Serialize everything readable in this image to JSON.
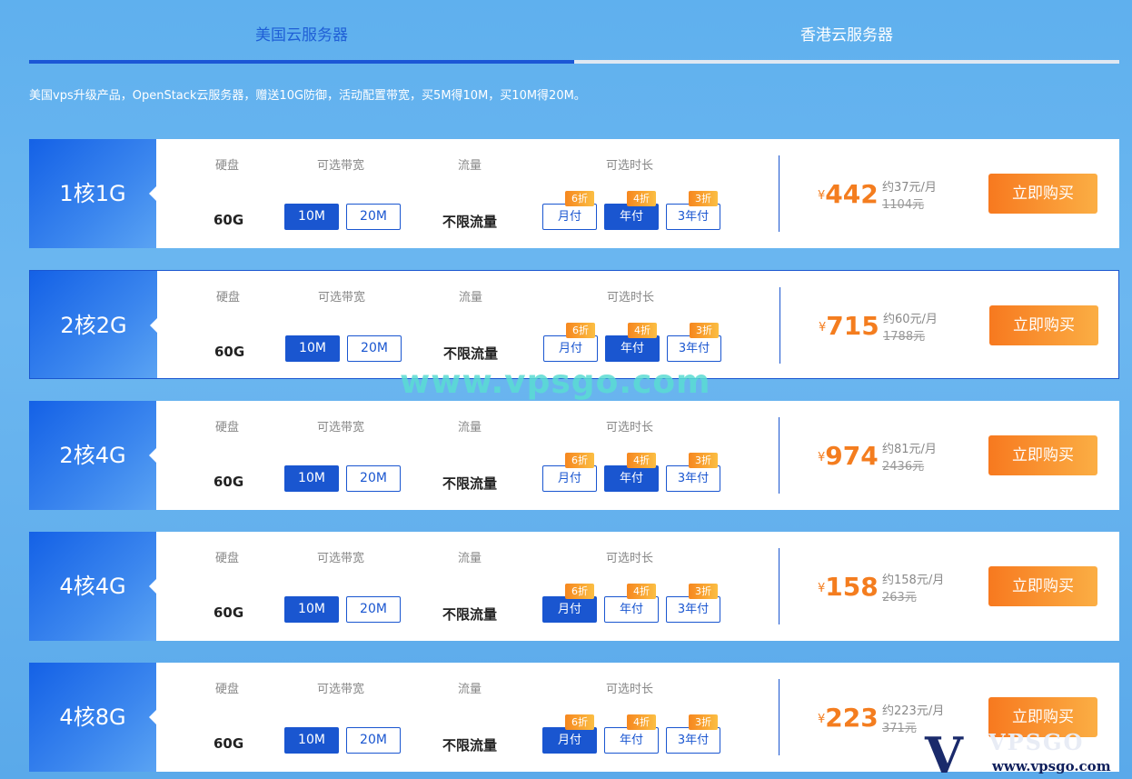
{
  "tabs": {
    "us": "美国云服务器",
    "hk": "香港云服务器"
  },
  "intro": "美国vps升级产品，OpenStack云服务器，赠送10G防御，活动配置带宽，买5M得10M，买10M得20M。",
  "labels": {
    "disk": "硬盘",
    "bandwidth": "可选带宽",
    "traffic": "流量",
    "duration": "可选时长"
  },
  "plans": [
    {
      "spec": "1核1G",
      "disk": "60G",
      "bw1": "10M",
      "bw2": "20M",
      "traffic": "不限流量",
      "d1": "月付",
      "d2": "年付",
      "d3": "3年付",
      "disc1": "6折",
      "disc2": "4折",
      "disc3": "3折",
      "selected_duration": "年付",
      "yen": "¥",
      "price": "442",
      "monthly": "约37元/月",
      "original": "1104元",
      "buy": "立即购买"
    },
    {
      "spec": "2核2G",
      "disk": "60G",
      "bw1": "10M",
      "bw2": "20M",
      "traffic": "不限流量",
      "d1": "月付",
      "d2": "年付",
      "d3": "3年付",
      "disc1": "6折",
      "disc2": "4折",
      "disc3": "3折",
      "selected_duration": "年付",
      "yen": "¥",
      "price": "715",
      "monthly": "约60元/月",
      "original": "1788元",
      "buy": "立即购买"
    },
    {
      "spec": "2核4G",
      "disk": "60G",
      "bw1": "10M",
      "bw2": "20M",
      "traffic": "不限流量",
      "d1": "月付",
      "d2": "年付",
      "d3": "3年付",
      "disc1": "6折",
      "disc2": "4折",
      "disc3": "3折",
      "selected_duration": "年付",
      "yen": "¥",
      "price": "974",
      "monthly": "约81元/月",
      "original": "2436元",
      "buy": "立即购买"
    },
    {
      "spec": "4核4G",
      "disk": "60G",
      "bw1": "10M",
      "bw2": "20M",
      "traffic": "不限流量",
      "d1": "月付",
      "d2": "年付",
      "d3": "3年付",
      "disc1": "6折",
      "disc2": "4折",
      "disc3": "3折",
      "selected_duration": "月付",
      "yen": "¥",
      "price": "158",
      "monthly": "约158元/月",
      "original": "263元",
      "buy": "立即购买"
    },
    {
      "spec": "4核8G",
      "disk": "60G",
      "bw1": "10M",
      "bw2": "20M",
      "traffic": "不限流量",
      "d1": "月付",
      "d2": "年付",
      "d3": "3年付",
      "disc1": "6折",
      "disc2": "4折",
      "disc3": "3折",
      "selected_duration": "月付",
      "yen": "¥",
      "price": "223",
      "monthly": "约223元/月",
      "original": "371元",
      "buy": "立即购买"
    }
  ],
  "watermark": "www.vpsgo.com",
  "logo": {
    "letter": "V",
    "word": "VPSGO",
    "url": "www.vpsgo.com"
  },
  "colors": {
    "accent": "#1a56d0",
    "price": "#f47d1f",
    "buy_button": "#f7791f"
  }
}
